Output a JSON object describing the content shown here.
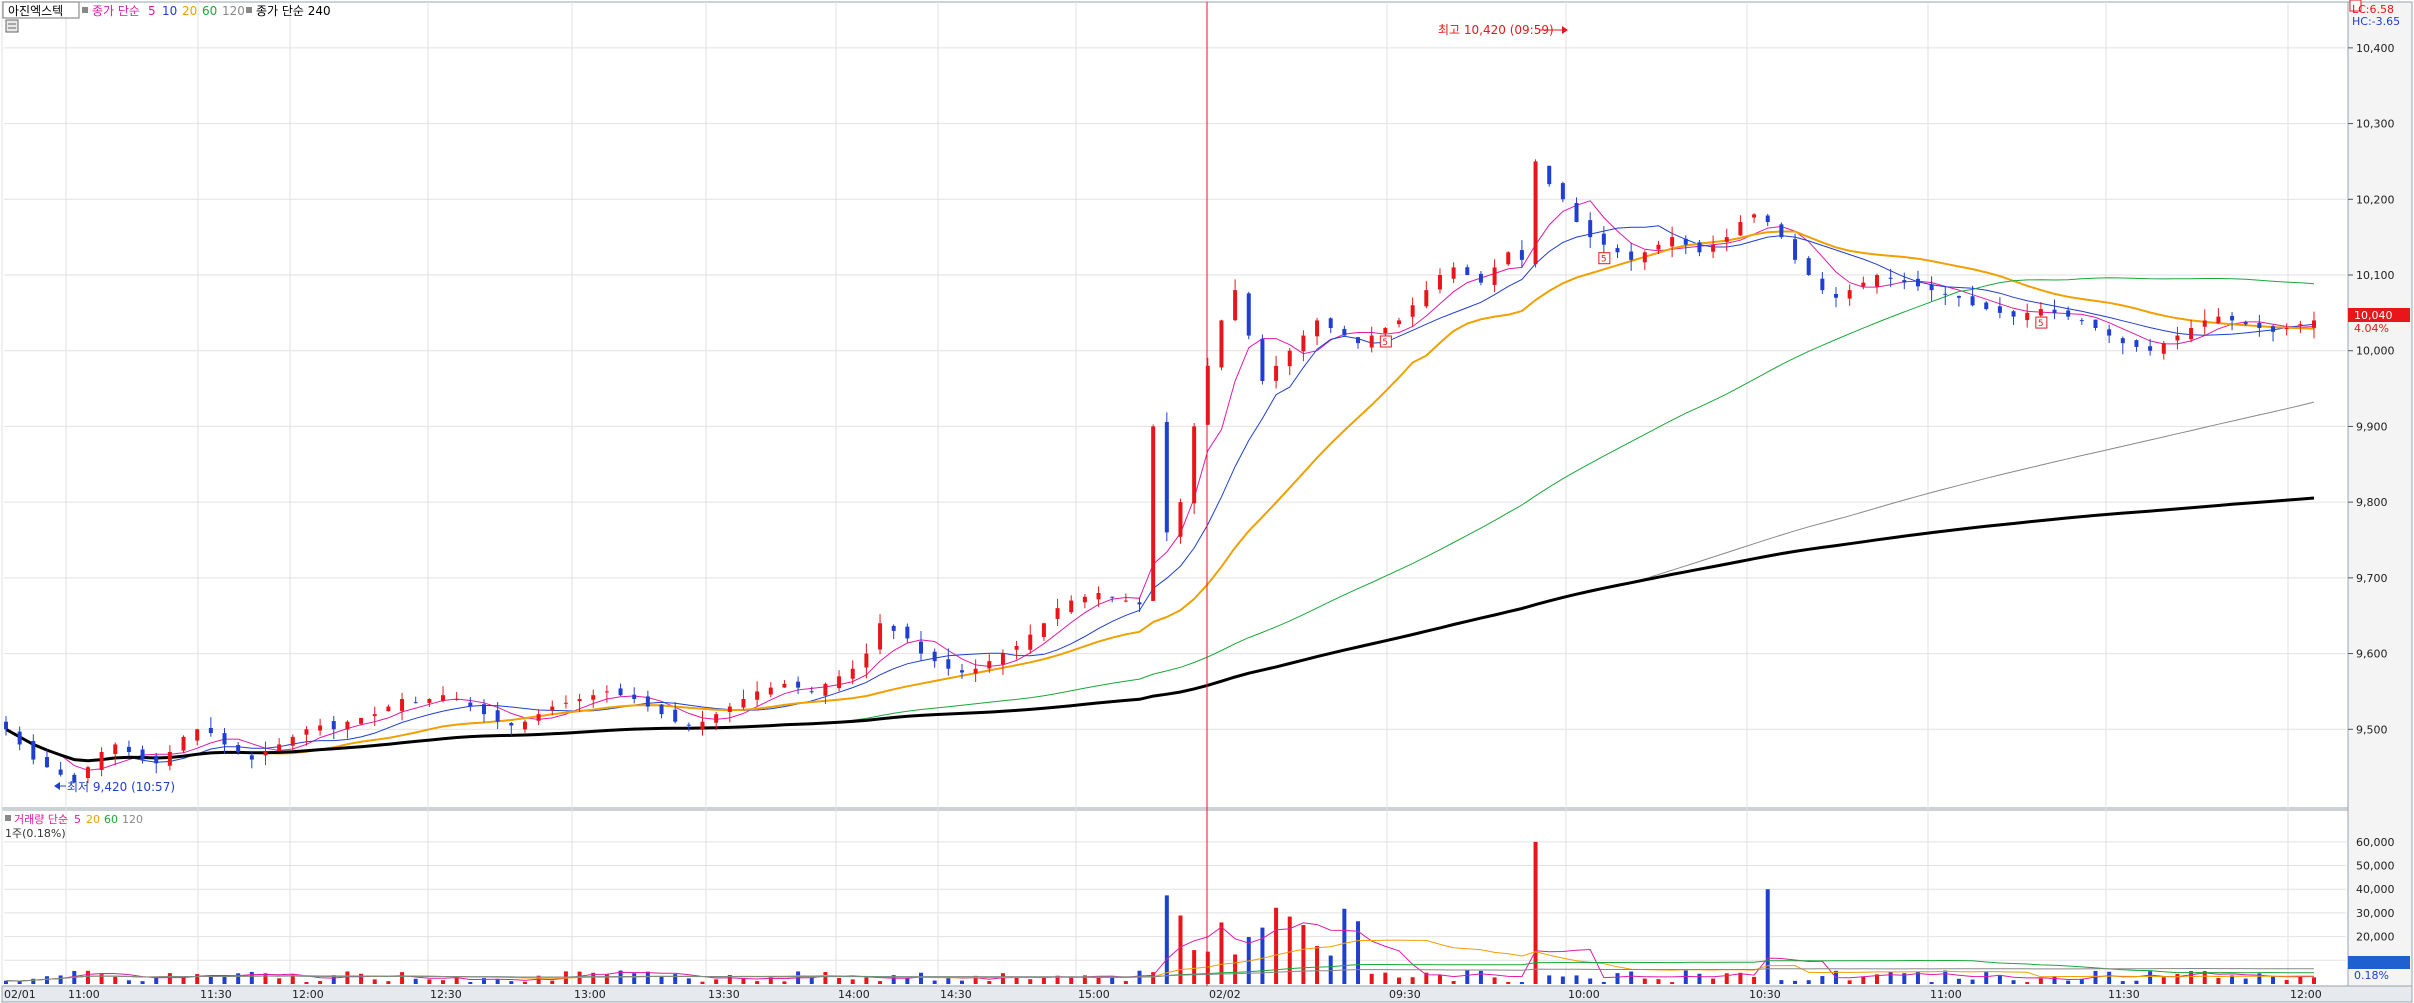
{
  "price_pane": {
    "legend": [
      {
        "text": "아진엑스텍",
        "color": "#000000",
        "boxed": true
      },
      {
        "text": "종가 단순",
        "color": "#e01aa8"
      },
      {
        "text": "5",
        "color": "#e01aa8"
      },
      {
        "text": "10",
        "color": "#1f3fd0"
      },
      {
        "text": "20",
        "color": "#f0a000"
      },
      {
        "text": "60",
        "color": "#1aa83a"
      },
      {
        "text": "120",
        "color": "#888888"
      },
      {
        "text": "종가 단순 240",
        "color": "#000000"
      }
    ],
    "high_annotation": "최고 10,420 (09:59)",
    "low_annotation": "최저 9,420 (10:57)",
    "lc_label": "LC:6.58",
    "hc_label": "HC:-3.65",
    "last_price_label": "10,040",
    "last_change_label": "4.04%",
    "markers": [
      "5",
      "5",
      "5",
      "5",
      "5",
      "5"
    ]
  },
  "volume_pane": {
    "legend": [
      {
        "text": "거래량 단순",
        "color": "#e01aa8"
      },
      {
        "text": "5",
        "color": "#e01aa8"
      },
      {
        "text": "20",
        "color": "#f0a000"
      },
      {
        "text": "60",
        "color": "#1aa83a"
      },
      {
        "text": "120",
        "color": "#888888"
      }
    ],
    "sub_label": "1주(0.18%)",
    "last_volume_label": "0.18%"
  },
  "chart_data": [
    {
      "type": "candlestick",
      "title": "아진엑스텍",
      "x_tick_labels": [
        "02/01",
        "11:00",
        "11:30",
        "12:00",
        "12:30",
        "13:00",
        "13:30",
        "14:00",
        "14:30",
        "15:00",
        "02/02",
        "09:30",
        "10:00",
        "10:30",
        "11:00",
        "11:30",
        "12:00"
      ],
      "y_tick_labels": [
        "9,500",
        "9,600",
        "9,700",
        "9,800",
        "9,900",
        "10,000",
        "10,100",
        "10,200",
        "10,300",
        "10,400"
      ],
      "ylim": [
        9400,
        10450
      ],
      "up_color": "#e8161b",
      "down_color": "#1f3fd0",
      "close_series": [
        9500,
        9480,
        9460,
        9450,
        9440,
        9430,
        9450,
        9470,
        9480,
        9470,
        9460,
        9455,
        9470,
        9490,
        9500,
        9495,
        9480,
        9470,
        9460,
        9470,
        9480,
        9490,
        9500,
        9505,
        9500,
        9510,
        9515,
        9520,
        9530,
        9540,
        9535,
        9540,
        9545,
        9540,
        9530,
        9520,
        9510,
        9505,
        9510,
        9520,
        9530,
        9535,
        9540,
        9545,
        9550,
        9545,
        9540,
        9530,
        9520,
        9510,
        9505,
        9510,
        9520,
        9530,
        9540,
        9550,
        9555,
        9560,
        9555,
        9550,
        9560,
        9570,
        9580,
        9600,
        9640,
        9630,
        9620,
        9600,
        9590,
        9580,
        9575,
        9580,
        9590,
        9600,
        9610,
        9625,
        9640,
        9660,
        9670,
        9675,
        9680,
        9675,
        9670,
        9665,
        9900,
        9760,
        9800,
        9900,
        9980,
        10040,
        10080,
        10020,
        9960,
        9980,
        10000,
        10020,
        10040,
        10030,
        10020,
        10010,
        10020,
        10030,
        10040,
        10060,
        10080,
        10100,
        10110,
        10100,
        10090,
        10110,
        10130,
        10120,
        10250,
        10220,
        10200,
        10170,
        10150,
        10140,
        10130,
        10120,
        10130,
        10140,
        10150,
        10140,
        10130,
        10140,
        10150,
        10170,
        10180,
        10170,
        10150,
        10120,
        10100,
        10080,
        10070,
        10080,
        10090,
        10100,
        10095,
        10090,
        10085,
        10080,
        10075,
        10070,
        10060,
        10055,
        10050,
        10045,
        10050,
        10055,
        10050,
        10045,
        10040,
        10030,
        10020,
        10010,
        10005,
        10000,
        10010,
        10020,
        10030,
        10040,
        10045,
        10040,
        10035,
        10030,
        10025,
        10030,
        10035,
        10040
      ]
    },
    {
      "type": "bar",
      "title": "거래량",
      "y_tick_labels": [
        "10,000",
        "20,000",
        "30,000",
        "40,000",
        "50,000",
        "60,000"
      ],
      "ylim": [
        0,
        65000
      ]
    }
  ]
}
